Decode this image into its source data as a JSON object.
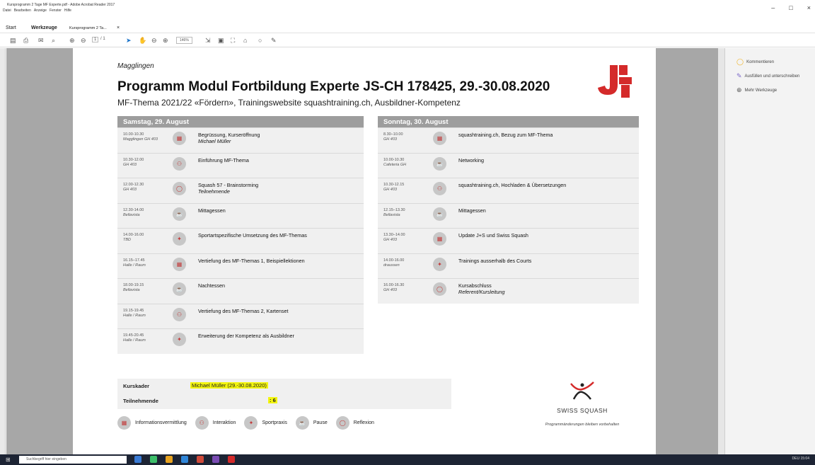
{
  "window": {
    "title": "Kursprogramm 2 Tage MF Experte.pdf - Adobe Acrobat Reader 2017",
    "menu": [
      "Datei",
      "Bearbeiten",
      "Anzeige",
      "Fenster",
      "Hilfe"
    ],
    "controls": [
      "–",
      "□",
      "×"
    ]
  },
  "tabs": {
    "start": "Start",
    "werkzeuge": "Werkzeuge",
    "document": "Kursprogramm 2 Ta...",
    "close": "×"
  },
  "toolbar": {
    "page_current": "1",
    "page_total": "/ 1",
    "zoom": "146%"
  },
  "sidebar": {
    "items": [
      {
        "label": "Kommentieren",
        "icon": "comment-icon",
        "color": "#f0b429"
      },
      {
        "label": "Ausfüllen und unterschreiben",
        "icon": "pen-icon",
        "color": "#7b68c9"
      },
      {
        "label": "Mehr Werkzeuge",
        "icon": "plus-circle-icon",
        "color": "#555555"
      }
    ]
  },
  "doc": {
    "place": "Magglingen",
    "title": "Programm Modul Fortbildung Experte JS-CH 178425, 29.-30.08.2020",
    "subtitle": "MF-Thema 2021/22 «Fördern», Trainingswebsite squashtraining.ch, Ausbildner-Kompetenz",
    "saturday": {
      "header": "Samstag, 29. August",
      "items": [
        {
          "time": "10.00-10.30",
          "loc": "Magglingen GH 403",
          "title": "Begrüssung, Kurseröffnung",
          "speaker": "Michael Müller",
          "icon": "info-icon"
        },
        {
          "time": "10.30-12.00",
          "loc": "GH 403",
          "title": "Einführung MF-Thema",
          "speaker": "",
          "icon": "interaction-icon"
        },
        {
          "time": "12.00-12.30",
          "loc": "GH 403",
          "title": "Squash 57 - Brainstorming",
          "speaker": "Teilnehmende",
          "icon": "reflection-icon"
        },
        {
          "time": "12.30-14.00",
          "loc": "Bellavista",
          "title": "Mittagessen",
          "speaker": "",
          "icon": "pause-icon"
        },
        {
          "time": "14.00-16.00",
          "loc": "TBD",
          "title": "Sportartspezifische Umsetzung des MF-Themas",
          "speaker": "",
          "icon": "sport-icon"
        },
        {
          "time": "16.15–17.45",
          "loc": "Halle / Raum",
          "title": "Vertiefung des MF-Themas 1, Beispiellektionen",
          "speaker": "",
          "icon": "info-icon"
        },
        {
          "time": "18.00-19.15",
          "loc": "Bellavista",
          "title": "Nachtessen",
          "speaker": "",
          "icon": "pause-icon"
        },
        {
          "time": "19.15-19.45",
          "loc": "Halle / Raum",
          "title": "Vertiefung des MF-Themas 2, Kartenset",
          "speaker": "",
          "icon": "interaction-icon"
        },
        {
          "time": "19.45-20.45",
          "loc": "Halle / Raum",
          "title": "Erweiterung der Kompetenz als Ausbildner",
          "speaker": "",
          "icon": "sport-icon"
        }
      ]
    },
    "sunday": {
      "header": "Sonntag, 30. August",
      "items": [
        {
          "time": "8.30–10.00",
          "loc": "GH 403",
          "title": "squashtraining.ch, Bezug zum MF-Thema",
          "speaker": "",
          "icon": "info-icon"
        },
        {
          "time": "10.00-10.30",
          "loc": "Cafeteria GH",
          "title": "Networking",
          "speaker": "",
          "icon": "pause-icon"
        },
        {
          "time": "10.30-12.15",
          "loc": "GH 403",
          "title": "squashtraining.ch, Hochladen & Übersetzungen",
          "speaker": "",
          "icon": "interaction-icon"
        },
        {
          "time": "12.15–13.30",
          "loc": "Bellavista",
          "title": "Mittagessen",
          "speaker": "",
          "icon": "pause-icon"
        },
        {
          "time": "13.30–14.00",
          "loc": "GH 403",
          "title": "Update J+S und Swiss Squash",
          "speaker": "",
          "icon": "info-icon"
        },
        {
          "time": "14.00-16.00",
          "loc": "draussen",
          "title": "Trainings ausserhalb des Courts",
          "speaker": "",
          "icon": "sport-icon"
        },
        {
          "time": "16.00-16.30",
          "loc": "GH 403",
          "title": "Kursabschluss",
          "speaker": "Referent/Kursleitung",
          "icon": "reflection-icon"
        }
      ]
    },
    "kurskader_label": "Kurskader",
    "kurskader_value": "Michael Müller (29.-30.08.2020)",
    "teilnehmende_label": "Teilnehmende",
    "teilnehmende_value": ": 6",
    "legend": [
      "Informationsvermittlung",
      "Interaktion",
      "Sportpraxis",
      "Pause",
      "Reflexion"
    ],
    "org": "SWISS SQUASH",
    "note": "Programmänderungen bleiben vorbehalten"
  },
  "taskbar": {
    "search": "Suchbegriff hier eingeben",
    "time": "15:04",
    "lang": "DEU"
  },
  "colors": {
    "accent": "#d42a2a",
    "header_gray": "#9d9d9d",
    "highlight": "#f3f50f"
  }
}
